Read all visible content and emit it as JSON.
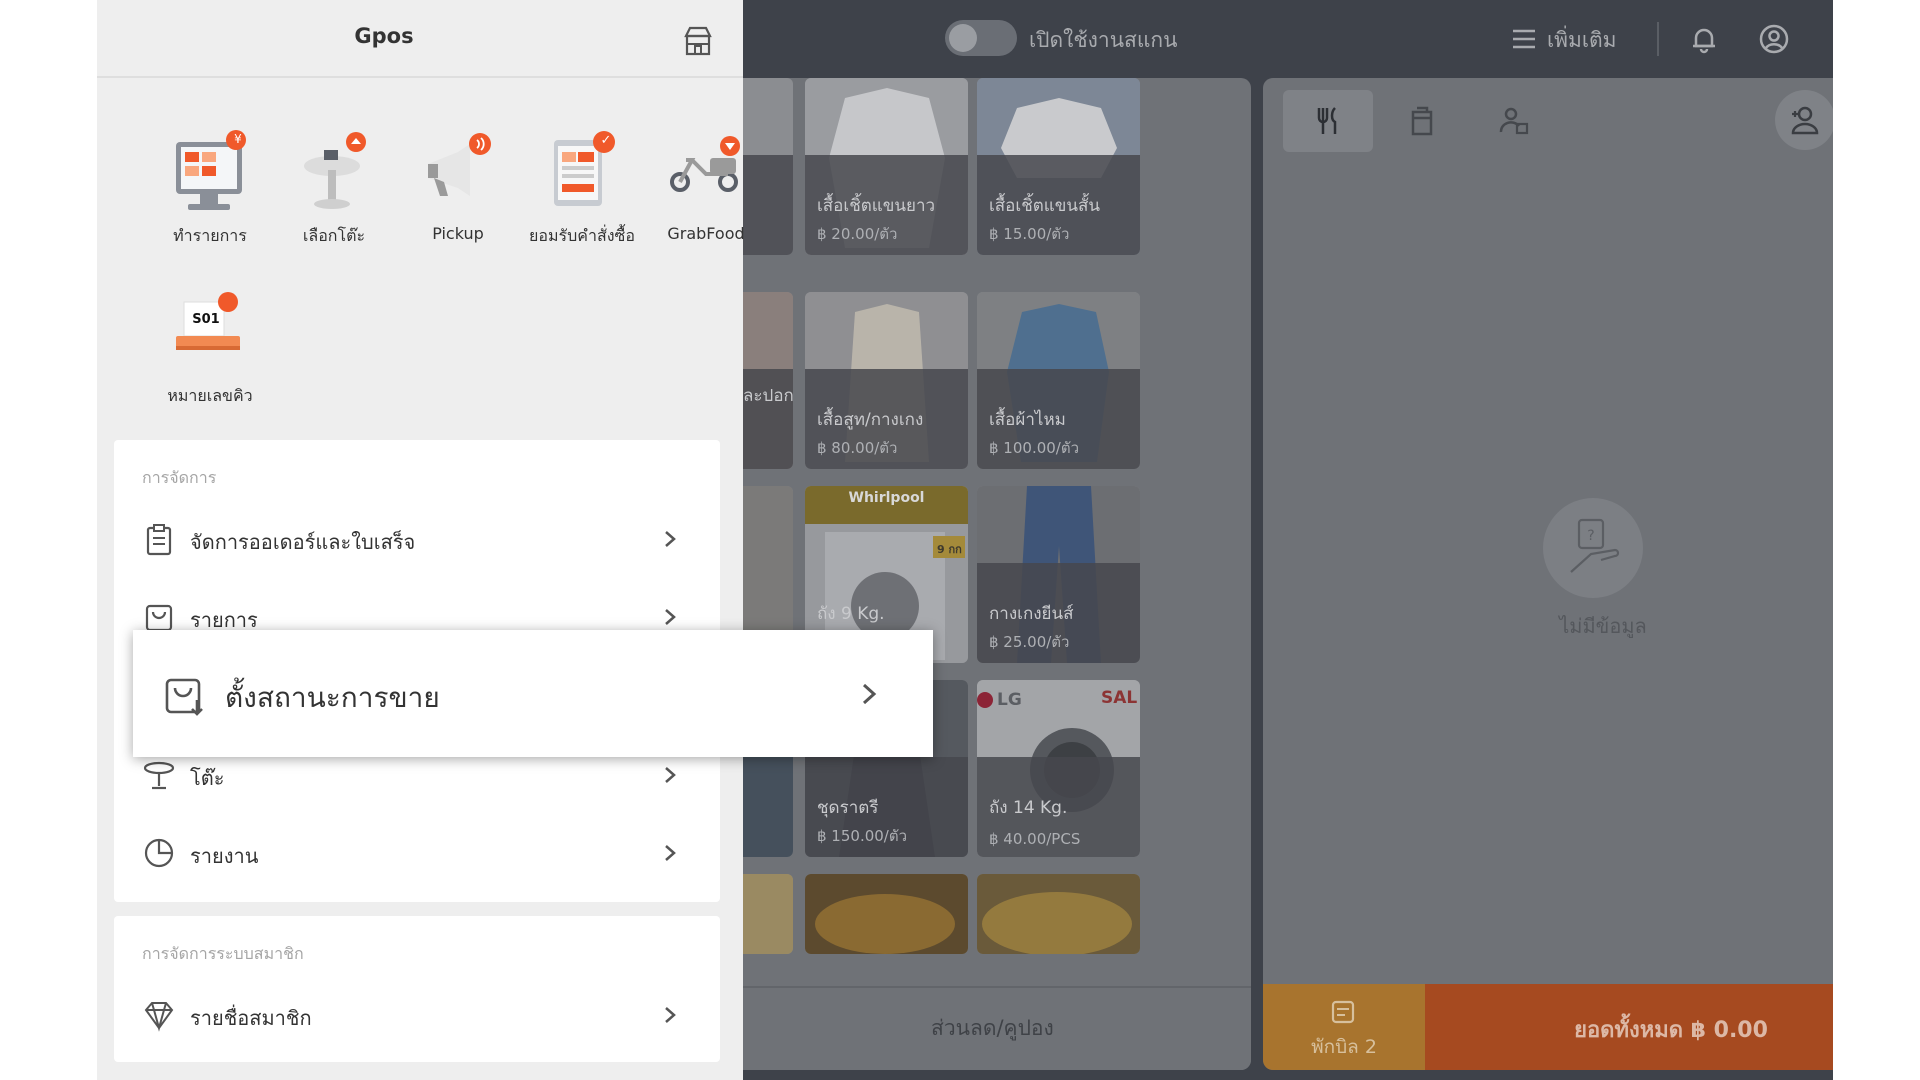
{
  "topbar": {
    "scan_label": "เปิดใช้งานสแกน",
    "more_label": "เพิ่มเติม"
  },
  "drawer": {
    "title": "Gpos",
    "apps": [
      {
        "label": "ทำรายการ",
        "badge": "¥"
      },
      {
        "label": "เลือกโต๊ะ",
        "badge": ""
      },
      {
        "label": "Pickup",
        "badge": ""
      },
      {
        "label": "ยอมรับคำสั่งซื้อ",
        "badge": "✓"
      },
      {
        "label": "GrabFood",
        "badge": ""
      },
      {
        "label": "หมายเลขคิว",
        "badge": "",
        "ticket": "S01"
      }
    ],
    "management": {
      "title": "การจัดการ",
      "rows": [
        "จัดการออเดอร์และใบเสร็จ",
        "รายการ",
        "โต๊ะ",
        "รายงาน"
      ]
    },
    "members": {
      "title": "การจัดการระบบสมาชิก",
      "rows": [
        "รายชื่อสมาชิก"
      ]
    },
    "popup_label": "ตั้งสถานะการขาย"
  },
  "catalog": {
    "items": [
      {
        "name": "เสื้อเชิ้ตแขนยาว",
        "price": "฿ 20.00/ตัว"
      },
      {
        "name": "เสื้อเชิ้ตแขนสั้น",
        "price": "฿ 15.00/ตัว"
      },
      {
        "name": "ละปอก",
        "price": ""
      },
      {
        "name": "เสื้อสูท/กางเกง",
        "price": "฿ 80.00/ตัว"
      },
      {
        "name": "เสื้อผ้าไหม",
        "price": "฿ 100.00/ตัว"
      },
      {
        "name": "ถัง 9 Kg.",
        "price": ""
      },
      {
        "name": "กางเกงยีนส์",
        "price": "฿ 25.00/ตัว"
      },
      {
        "name": "ชุดราตรี",
        "price": "฿ 150.00/ตัว"
      },
      {
        "name": "ถัง 14 Kg.",
        "price": "฿ 40.00/PCS"
      }
    ],
    "art_texts": {
      "brand1": "Whirlpool",
      "brand2": "LG",
      "sale": "SAL",
      "kg": "9 กก"
    },
    "coupon_label": "ส่วนลด/คูปอง"
  },
  "cart": {
    "empty_label": "ไม่มีข้อมูล",
    "hold_label": "พักบิล 2",
    "total_label": "ยอดทั้งหมด ฿ 0.00"
  },
  "colors": {
    "accent": "#f0592a",
    "drawer_bg": "#eeeeee",
    "overlay": "#3e424a"
  }
}
